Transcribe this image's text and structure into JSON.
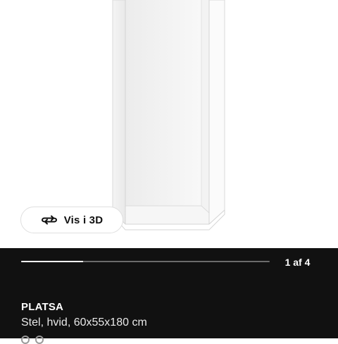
{
  "view3d": {
    "label": "Vis i 3D",
    "icon": "rotate-3d-icon"
  },
  "gallery": {
    "counter": "1 af 4",
    "current": 1,
    "total": 4,
    "progress_fraction": 0.25
  },
  "product": {
    "name": "PLATSA",
    "description": "Stel, hvid, 60x55x180 cm"
  },
  "colors": {
    "panel_background": "#111111",
    "progress_track": "#6b6b6b",
    "progress_fill": "#ffffff"
  }
}
